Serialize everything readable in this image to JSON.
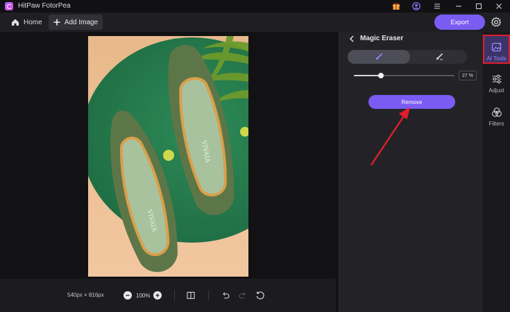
{
  "app": {
    "title": "HitPaw FotorPea"
  },
  "toolbar": {
    "home_label": "Home",
    "add_image_label": "Add Image",
    "export_label": "Export"
  },
  "canvas": {
    "dimensions": "540px × 816px",
    "zoom": "100%"
  },
  "panel": {
    "title": "Magic Eraser",
    "brush_percent": "27 %",
    "brush_value": 0.27,
    "remove_label": "Remove"
  },
  "rail": {
    "ai_tools_label": "AI Tools",
    "adjust_label": "Adjust",
    "filters_label": "Filters"
  },
  "colors": {
    "accent": "#7a5cf3",
    "highlight": "#e01f2b"
  },
  "icons": [
    "app-logo-icon",
    "gift-icon",
    "user-icon",
    "menu-icon",
    "minimize-icon",
    "maximize-icon",
    "close-icon",
    "home-icon",
    "plus-icon",
    "gear-icon",
    "brush-icon",
    "eraser-icon",
    "chevron-left-icon",
    "compare-icon",
    "undo-icon",
    "redo-icon",
    "reset-icon",
    "ai-tools-icon",
    "adjust-icon",
    "filters-icon"
  ]
}
